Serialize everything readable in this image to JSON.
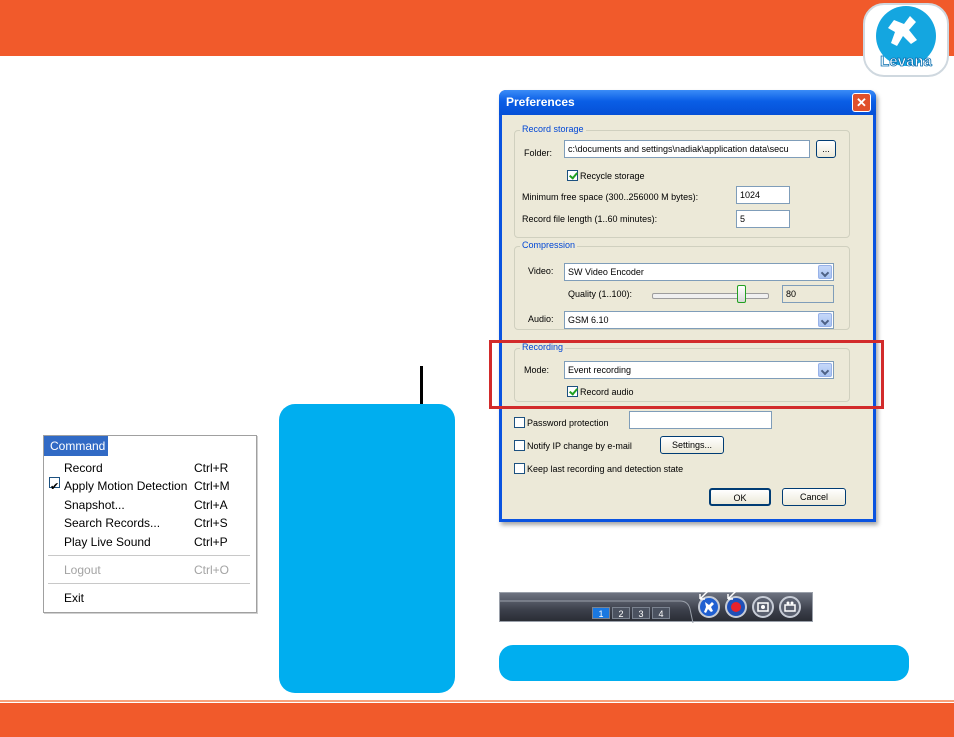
{
  "colors": {
    "brand_orange": "#f15a2b",
    "callout_blue": "#00aeef",
    "highlight_red": "#d22b2b"
  },
  "logo": {
    "text": "Levana"
  },
  "command_menu": {
    "title": "Command",
    "items": [
      {
        "label": "Record",
        "shortcut": "Ctrl+R",
        "checked": false,
        "disabled": false
      },
      {
        "label": "Apply Motion Detection",
        "shortcut": "Ctrl+M",
        "checked": true,
        "disabled": false
      },
      {
        "label": "Snapshot...",
        "shortcut": "Ctrl+A",
        "checked": false,
        "disabled": false
      },
      {
        "label": "Search Records...",
        "shortcut": "Ctrl+S",
        "checked": false,
        "disabled": false
      },
      {
        "label": "Play Live Sound",
        "shortcut": "Ctrl+P",
        "checked": false,
        "disabled": false
      },
      {
        "label": "Logout",
        "shortcut": "Ctrl+O",
        "checked": false,
        "disabled": true
      },
      {
        "label": "Exit",
        "shortcut": "",
        "checked": false,
        "disabled": false
      }
    ],
    "check_mark": "✔"
  },
  "preferences": {
    "title": "Preferences",
    "close_glyph": "✕",
    "record_storage": {
      "group_label": "Record storage",
      "folder_label": "Folder:",
      "folder_value": "c:\\documents and settings\\nadiak\\application data\\secu",
      "browse_label": "...",
      "recycle_label": "Recycle storage",
      "recycle_checked": true,
      "min_free_label": "Minimum free space (300..256000 M bytes):",
      "min_free_value": "1024",
      "file_length_label": "Record file length (1..60 minutes):",
      "file_length_value": "5"
    },
    "compression": {
      "group_label": "Compression",
      "video_label": "Video:",
      "video_value": "SW Video Encoder",
      "quality_label": "Quality (1..100):",
      "quality_value": "80",
      "quality_level": 80,
      "audio_label": "Audio:",
      "audio_value": "GSM 6.10"
    },
    "recording": {
      "group_label": "Recording",
      "mode_label": "Mode:",
      "mode_value": "Event recording",
      "record_audio_label": "Record audio",
      "record_audio_checked": true
    },
    "password_label": "Password protection",
    "password_value": "",
    "notify_label": "Notify IP change by e-mail",
    "settings_label": "Settings...",
    "keep_label": "Keep last recording and detection state",
    "ok_label": "OK",
    "cancel_label": "Cancel"
  },
  "toolbar": {
    "tabs": [
      "1",
      "2",
      "3",
      "4"
    ],
    "active_tab": "1",
    "buttons": [
      "motion-detection-icon",
      "record-icon",
      "snapshot-icon",
      "search-records-icon"
    ]
  }
}
